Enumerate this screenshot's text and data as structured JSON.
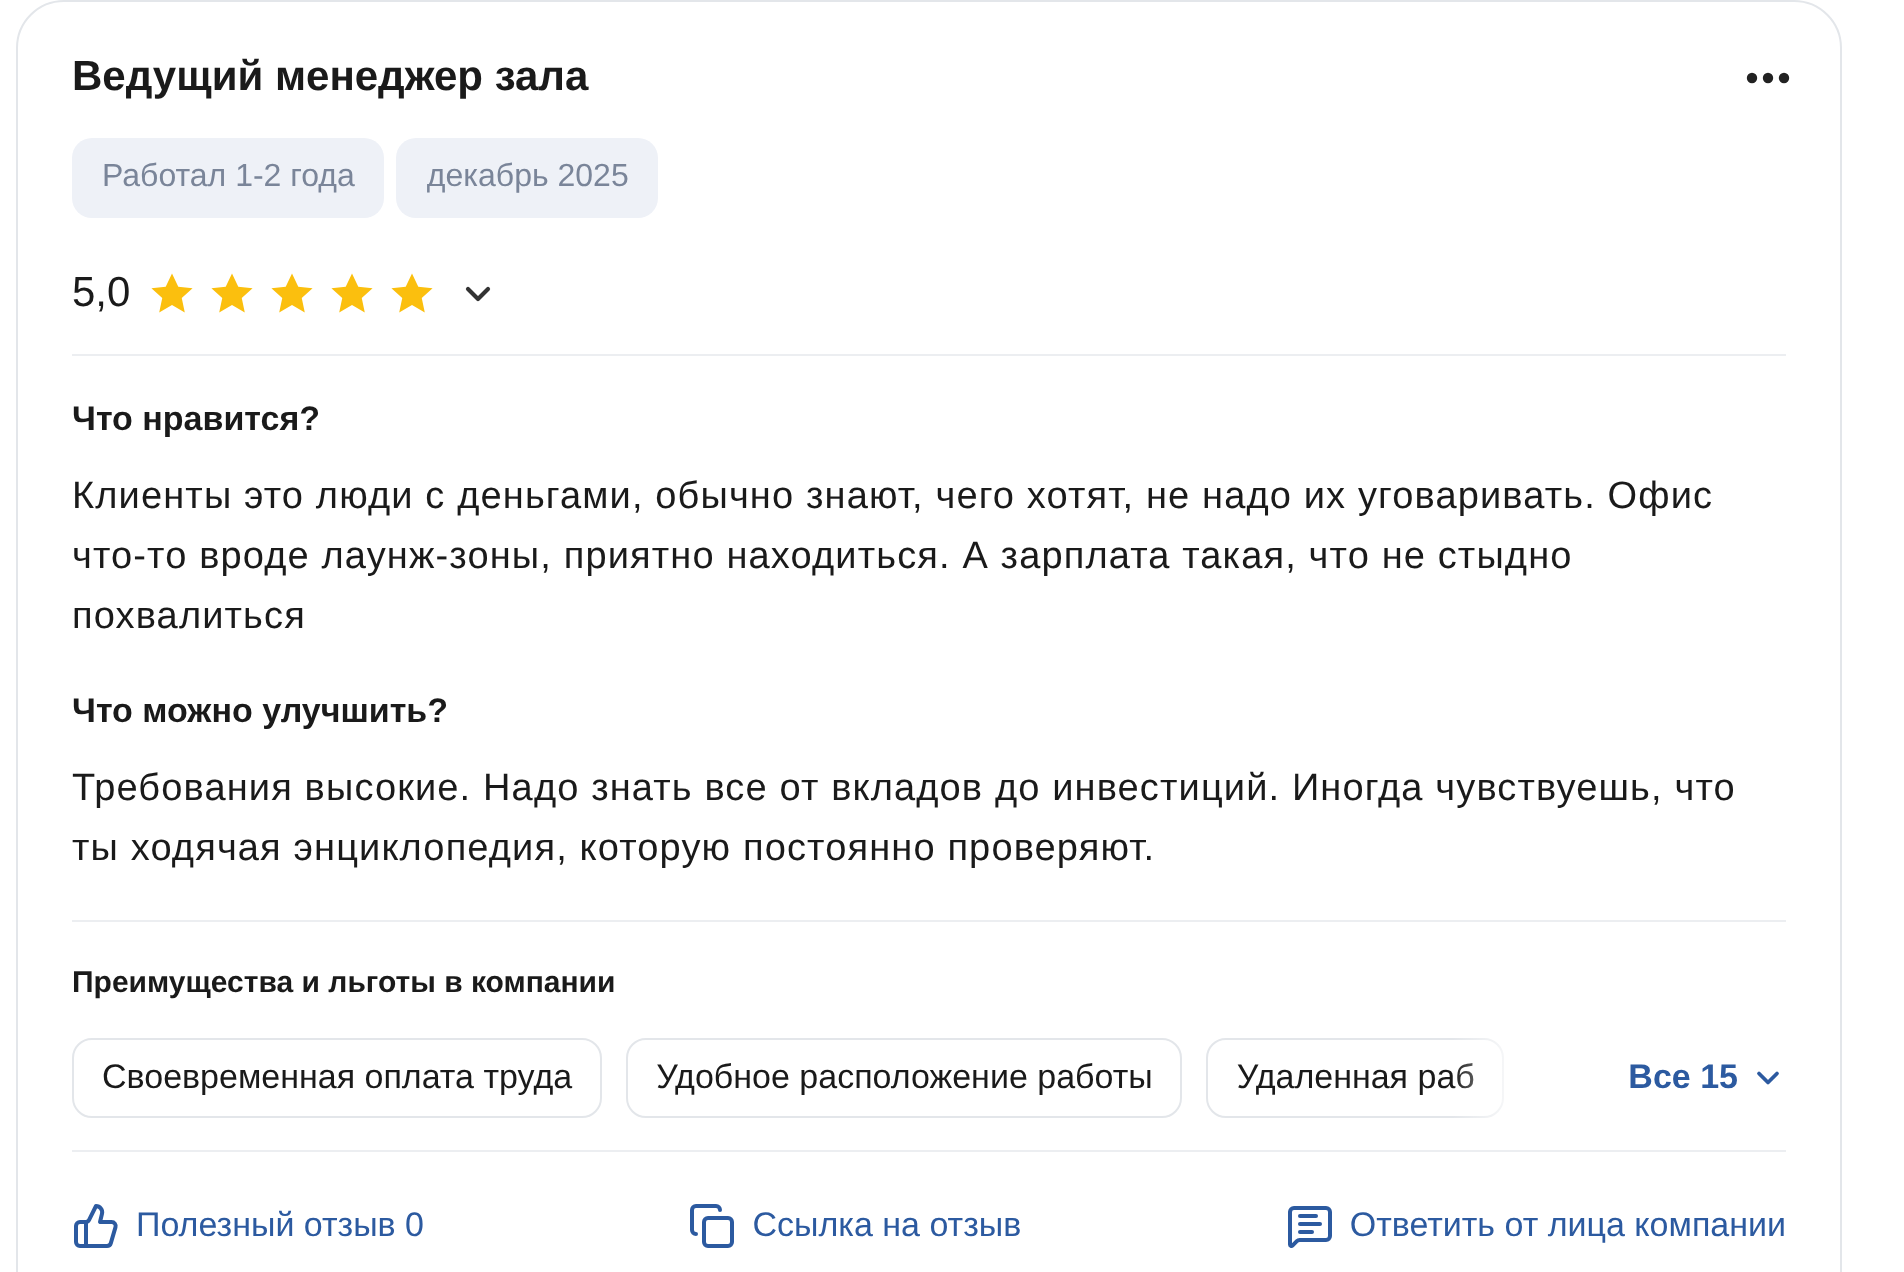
{
  "review": {
    "title": "Ведущий менеджер зала",
    "tags": [
      "Работал 1-2 года",
      "декабрь 2025"
    ],
    "rating": "5,0",
    "stars": 5,
    "sections": [
      {
        "heading": "Что нравится?",
        "text": "Клиенты это люди с деньгами, обычно знают, чего хотят, не надо их уговаривать. Офис что-то вроде лаунж-зоны, приятно находиться. А зарплата такая, что не стыдно похвалиться"
      },
      {
        "heading": "Что можно улучшить?",
        "text": "Требования высокие. Надо знать все от вкладов до инвестиций. Иногда чувствуешь, что ты ходячая энциклопедия, которую постоянно проверяют."
      }
    ],
    "benefits": {
      "heading": "Преимущества и льготы в компании",
      "items": [
        "Своевременная оплата труда",
        "Удобное расположение работы",
        "Удаленная раб"
      ],
      "more": "Все 15"
    },
    "actions": [
      {
        "kind": "like",
        "label": "Полезный отзыв 0"
      },
      {
        "kind": "link",
        "label": "Ссылка на отзыв"
      },
      {
        "kind": "reply",
        "label": "Ответить от лица компании"
      }
    ]
  }
}
